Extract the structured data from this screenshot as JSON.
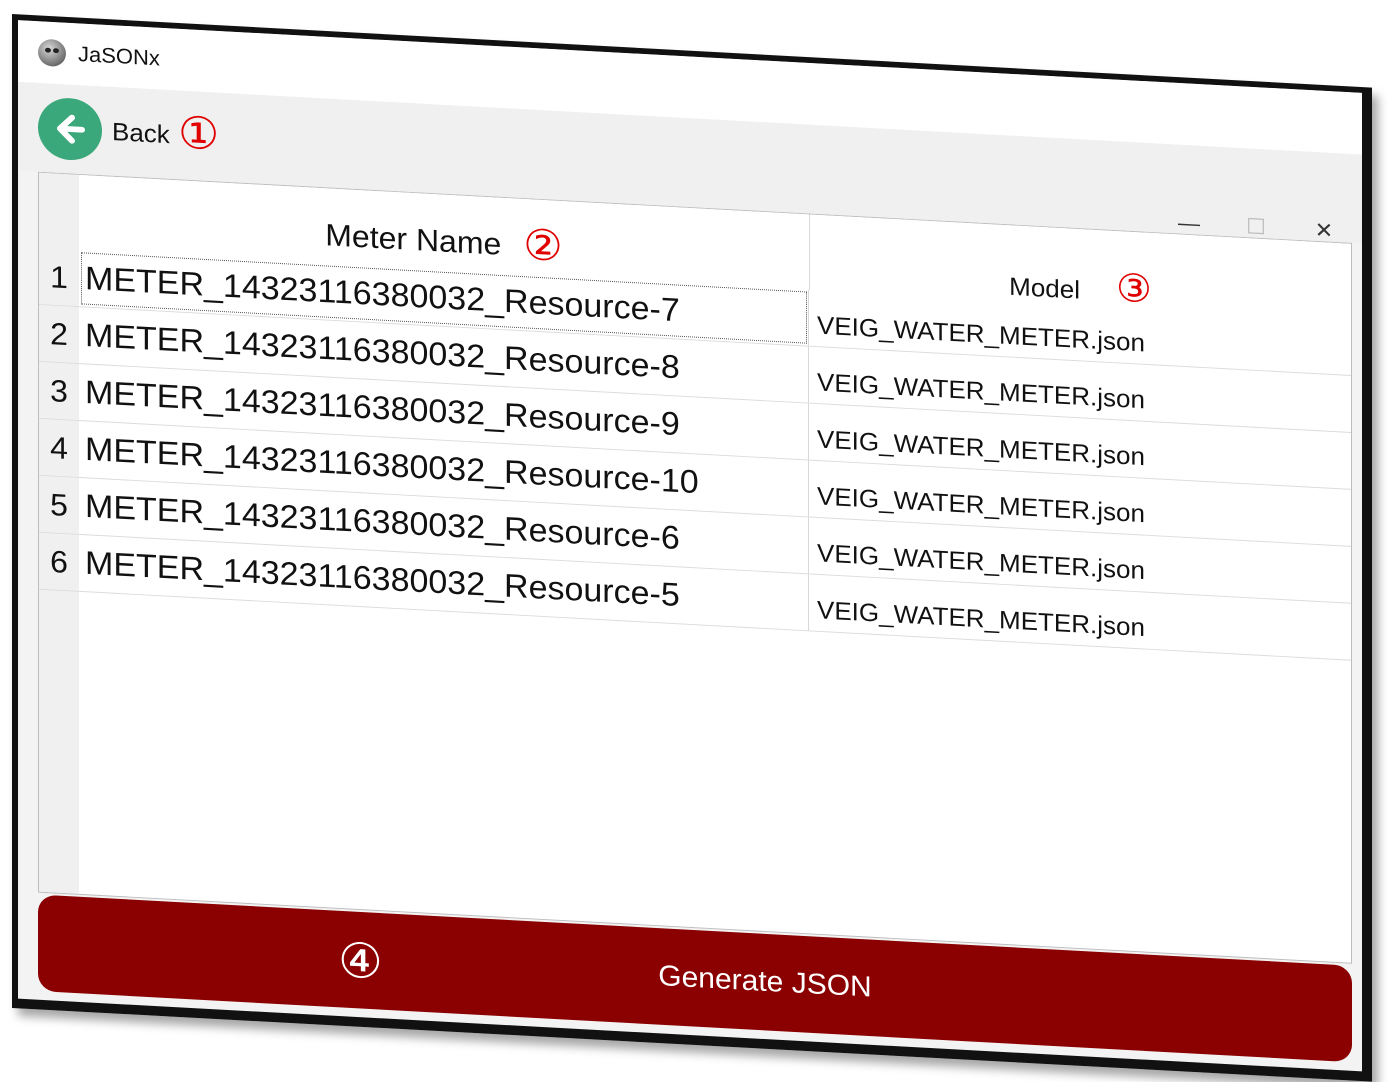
{
  "app": {
    "title": "JaSONx"
  },
  "toolbar": {
    "back_label": "Back"
  },
  "window_controls": {
    "minimize": "—",
    "maximize": "☐",
    "close": "✕"
  },
  "annotations": [
    "①",
    "②",
    "③",
    "④"
  ],
  "table": {
    "columns": {
      "name": "Meter Name",
      "model": "Model"
    },
    "rows": [
      {
        "num": "1",
        "name": "METER_14323116380032_Resource-7",
        "model": "VEIG_WATER_METER.json"
      },
      {
        "num": "2",
        "name": "METER_14323116380032_Resource-8",
        "model": "VEIG_WATER_METER.json"
      },
      {
        "num": "3",
        "name": "METER_14323116380032_Resource-9",
        "model": "VEIG_WATER_METER.json"
      },
      {
        "num": "4",
        "name": "METER_14323116380032_Resource-10",
        "model": "VEIG_WATER_METER.json"
      },
      {
        "num": "5",
        "name": "METER_14323116380032_Resource-6",
        "model": "VEIG_WATER_METER.json"
      },
      {
        "num": "6",
        "name": "METER_14323116380032_Resource-5",
        "model": "VEIG_WATER_METER.json"
      }
    ]
  },
  "actions": {
    "generate_label": "Generate JSON"
  },
  "colors": {
    "back_button": "#3aa87a",
    "generate_button": "#8b0000",
    "annotation": "#e00000"
  }
}
